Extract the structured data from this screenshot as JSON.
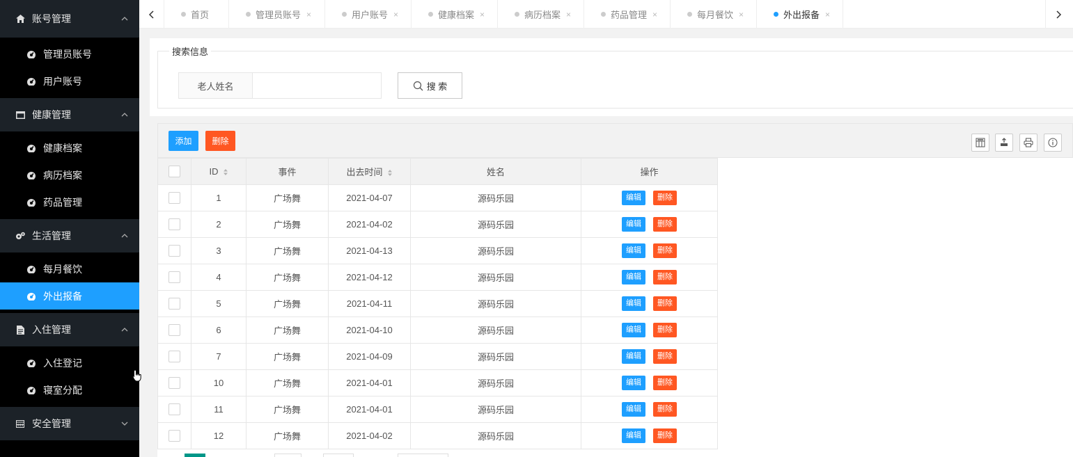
{
  "sidebar": {
    "groups": [
      {
        "label": "账号管理",
        "icon": "home-icon",
        "items": [
          {
            "label": "管理员账号"
          },
          {
            "label": "用户账号"
          }
        ]
      },
      {
        "label": "健康管理",
        "icon": "window-icon",
        "items": [
          {
            "label": "健康档案"
          },
          {
            "label": "病历档案"
          },
          {
            "label": "药品管理"
          }
        ]
      },
      {
        "label": "生活管理",
        "icon": "gears-icon",
        "items": [
          {
            "label": "每月餐饮"
          },
          {
            "label": "外出报备"
          }
        ]
      },
      {
        "label": "入住管理",
        "icon": "file-icon",
        "items": [
          {
            "label": "入住登记"
          },
          {
            "label": "寝室分配"
          }
        ]
      },
      {
        "label": "安全管理",
        "icon": "calendar-icon",
        "items": []
      }
    ],
    "active_item": "外出报备"
  },
  "tabs": [
    {
      "label": "首页"
    },
    {
      "label": "管理员账号"
    },
    {
      "label": "用户账号"
    },
    {
      "label": "健康档案"
    },
    {
      "label": "病历档案"
    },
    {
      "label": "药品管理"
    },
    {
      "label": "每月餐饮"
    },
    {
      "label": "外出报备"
    }
  ],
  "tab_close_glyph": "×",
  "search": {
    "legend": "搜索信息",
    "field_label": "老人姓名",
    "field_value": "",
    "field_placeholder": "",
    "button_label": "搜 索"
  },
  "toolbar": {
    "add_label": "添加",
    "delete_label": "删除"
  },
  "table": {
    "columns": {
      "id": "ID",
      "event": "事件",
      "time": "出去时间",
      "name": "姓名",
      "action": "操作"
    },
    "edit_label": "编辑",
    "delete_label": "删除",
    "rows": [
      {
        "id": "1",
        "event": "广场舞",
        "time": "2021-04-07",
        "name": "源码乐园"
      },
      {
        "id": "2",
        "event": "广场舞",
        "time": "2021-04-02",
        "name": "源码乐园"
      },
      {
        "id": "3",
        "event": "广场舞",
        "time": "2021-04-13",
        "name": "源码乐园"
      },
      {
        "id": "4",
        "event": "广场舞",
        "time": "2021-04-12",
        "name": "源码乐园"
      },
      {
        "id": "5",
        "event": "广场舞",
        "time": "2021-04-11",
        "name": "源码乐园"
      },
      {
        "id": "6",
        "event": "广场舞",
        "time": "2021-04-10",
        "name": "源码乐园"
      },
      {
        "id": "7",
        "event": "广场舞",
        "time": "2021-04-09",
        "name": "源码乐园"
      },
      {
        "id": "10",
        "event": "广场舞",
        "time": "2021-04-01",
        "name": "源码乐园"
      },
      {
        "id": "11",
        "event": "广场舞",
        "time": "2021-04-01",
        "name": "源码乐园"
      },
      {
        "id": "12",
        "event": "广场舞",
        "time": "2021-04-02",
        "name": "源码乐园"
      }
    ]
  },
  "colors": {
    "primary": "#1E9FFF",
    "danger": "#FF5722",
    "sidebar_bg": "#000000",
    "sidebar_group_bg": "#1c2228"
  }
}
